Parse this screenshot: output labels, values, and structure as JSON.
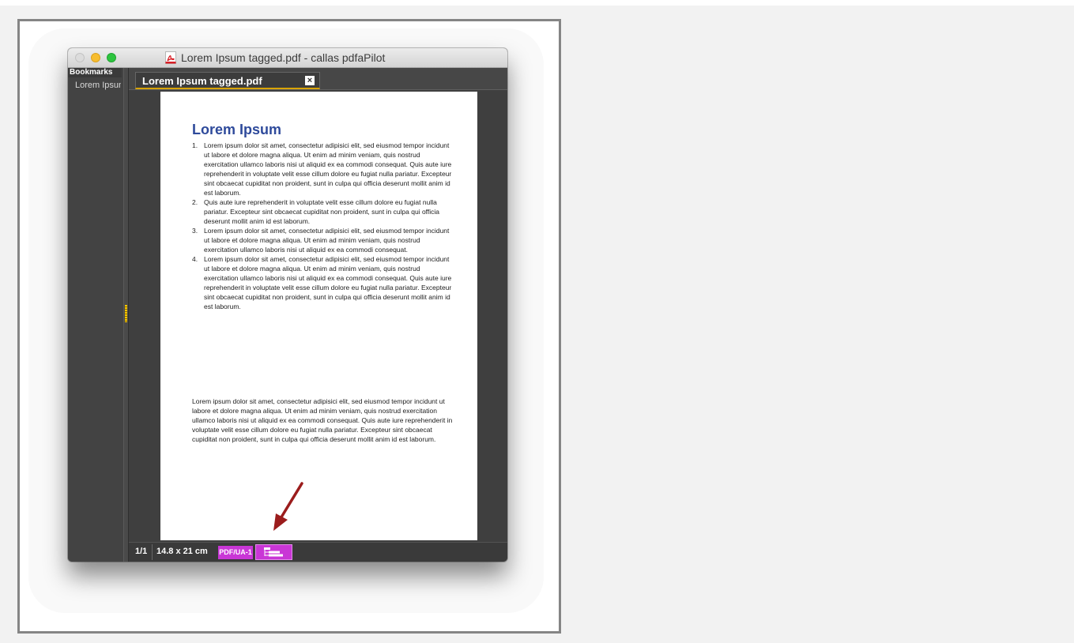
{
  "window": {
    "title": "Lorem Ipsum tagged.pdf - callas pdfaPilot",
    "traffic_lights": [
      "close",
      "minimize",
      "zoom"
    ]
  },
  "bookmarks": {
    "title": "Bookmarks",
    "items": [
      "Lorem Ipsum"
    ]
  },
  "tab": {
    "label": "Lorem Ipsum tagged.pdf",
    "close_glyph": "×"
  },
  "document": {
    "heading": "Lorem Ipsum",
    "list": [
      {
        "num": "1.",
        "text": "Lorem ipsum dolor sit amet, consectetur adipisici elit, sed eiusmod tempor incidunt ut labore et dolore magna aliqua. Ut enim ad minim veniam, quis nostrud exercitation ullamco laboris nisi ut aliquid ex ea commodi consequat. Quis aute iure reprehenderit in voluptate velit esse cillum dolore eu fugiat nulla pariatur. Excepteur sint obcaecat cupiditat non proident, sunt in culpa qui officia deserunt mollit anim id est laborum."
      },
      {
        "num": "2.",
        "text": "Quis aute iure reprehenderit in voluptate velit esse cillum dolore eu fugiat nulla pariatur. Excepteur sint obcaecat cupiditat non proident, sunt in culpa qui officia deserunt mollit anim id est laborum."
      },
      {
        "num": "3.",
        "text": "Lorem ipsum dolor sit amet, consectetur adipisici elit, sed eiusmod tempor incidunt ut labore et dolore magna aliqua. Ut enim ad minim veniam, quis nostrud exercitation ullamco laboris nisi ut aliquid ex ea commodi consequat."
      },
      {
        "num": "4.",
        "text": "Lorem ipsum dolor sit amet, consectetur adipisici elit, sed eiusmod tempor incidunt ut labore et dolore magna aliqua. Ut enim ad minim veniam, quis nostrud exercitation ullamco laboris nisi ut aliquid ex ea commodi consequat. Quis aute iure reprehenderit in voluptate velit esse cillum dolore eu fugiat nulla pariatur. Excepteur sint obcaecat cupiditat non proident, sunt in culpa qui officia deserunt mollit anim id est laborum."
      }
    ],
    "paragraph": "Lorem ipsum dolor sit amet, consectetur adipisici elit, sed eiusmod tempor incidunt ut labore et dolore magna aliqua. Ut enim ad minim veniam, quis nostrud exercitation ullamco laboris nisi ut aliquid ex ea commodi consequat. Quis aute iure reprehenderit in voluptate velit esse cillum dolore eu fugiat nulla pariatur. Excepteur sint obcaecat cupiditat non proident, sunt in culpa qui officia deserunt mollit anim id est laborum."
  },
  "statusbar": {
    "page": "1/1",
    "size": "14.8 x 21 cm",
    "badge": "PDF/UA-1",
    "structure_icon": "structure-tree-icon"
  },
  "colors": {
    "heading": "#2e4a9b",
    "badge": "#c936d6",
    "tab_accent": "#d9a400",
    "arrow": "#9b1c1c"
  },
  "icons": {
    "title_file": "pdf-file-icon",
    "annotation": "red-arrow-icon"
  }
}
